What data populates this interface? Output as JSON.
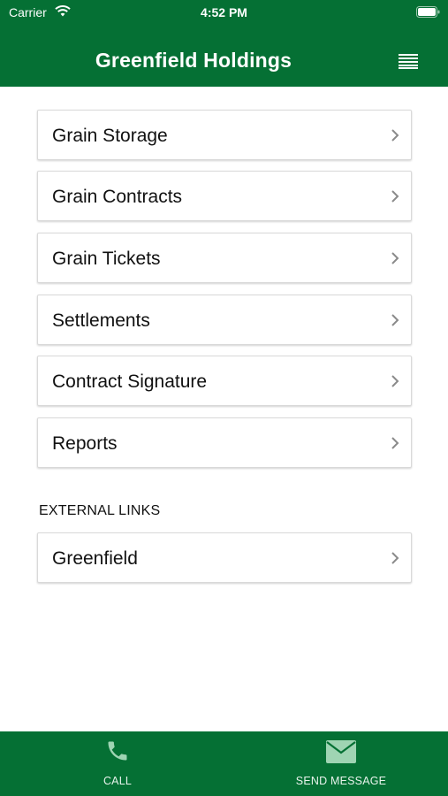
{
  "status_bar": {
    "carrier": "Carrier",
    "time": "4:52 PM"
  },
  "header": {
    "title": "Greenfield Holdings",
    "menu_icon": "list-menu-icon"
  },
  "menu": {
    "items": [
      {
        "label": "Grain Storage"
      },
      {
        "label": "Grain Contracts"
      },
      {
        "label": "Grain Tickets"
      },
      {
        "label": "Settlements"
      },
      {
        "label": "Contract Signature"
      },
      {
        "label": "Reports"
      }
    ]
  },
  "external_links": {
    "header": "EXTERNAL LINKS",
    "items": [
      {
        "label": "Greenfield"
      }
    ]
  },
  "tab_bar": {
    "call": {
      "label": "CALL",
      "icon": "phone-icon"
    },
    "send_message": {
      "label": "SEND MESSAGE",
      "icon": "envelope-icon"
    }
  },
  "colors": {
    "brand_green": "#057034",
    "tab_icon": "#9fd4b3"
  }
}
